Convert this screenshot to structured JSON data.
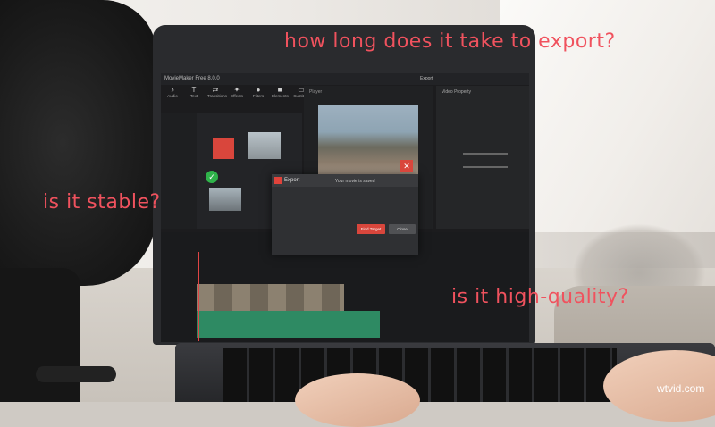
{
  "app": {
    "title": "MovieMaker Free 8.0.0",
    "toolbar": [
      "Audio",
      "Text",
      "Transitions",
      "Effects",
      "Filters",
      "Elements",
      "Subtitles"
    ],
    "export_button": "Export",
    "right_panel_title": "Video Property",
    "preview_label": "Player"
  },
  "dialog": {
    "title": "Export",
    "message": "Your movie is saved",
    "open_button": "Find Target",
    "close_button": "Close"
  },
  "captions": {
    "top": "how long does it take to export?",
    "left": "is it stable?",
    "right": "is it high-quality?"
  },
  "watermark": "wtvid.com"
}
